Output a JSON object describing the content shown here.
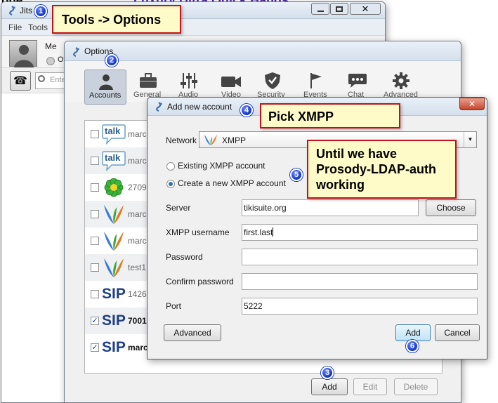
{
  "top_fragments": {
    "left": "one ...",
    "link": "Luxury Ultra Quick Hands"
  },
  "main_window": {
    "title": "Jits",
    "menu": [
      "File",
      "Tools"
    ],
    "profile_name": "Me",
    "status_fragment": "Ot",
    "search_placeholder": "Ente"
  },
  "options_window": {
    "title": "Options",
    "tabs": [
      {
        "label": "Accounts",
        "icon": "person-icon"
      },
      {
        "label": "General",
        "icon": "briefcase-icon"
      },
      {
        "label": "Audio",
        "icon": "sliders-icon"
      },
      {
        "label": "Video",
        "icon": "camera-icon"
      },
      {
        "label": "Security",
        "icon": "shield-icon"
      },
      {
        "label": "Events",
        "icon": "flag-icon"
      },
      {
        "label": "Chat",
        "icon": "chat-bubble-icon"
      },
      {
        "label": "Advanced",
        "icon": "gear-icon"
      }
    ],
    "accounts": [
      {
        "checked": false,
        "protocol": "talk",
        "name": "marc",
        "bold": false
      },
      {
        "checked": false,
        "protocol": "talk",
        "name": "marc",
        "bold": false
      },
      {
        "checked": false,
        "protocol": "icq",
        "name": "2709",
        "bold": false
      },
      {
        "checked": false,
        "protocol": "xmpp",
        "name": "marc",
        "bold": false
      },
      {
        "checked": false,
        "protocol": "xmpp",
        "name": "marc",
        "bold": false
      },
      {
        "checked": false,
        "protocol": "xmpp",
        "name": "test1",
        "bold": false
      },
      {
        "checked": false,
        "protocol": "sip",
        "name": "1426",
        "bold": false
      },
      {
        "checked": true,
        "protocol": "sip",
        "name": "7001",
        "bold": true
      },
      {
        "checked": true,
        "protocol": "sip",
        "name": "marc",
        "bold": true
      }
    ],
    "protocol_text": {
      "talk": "talk",
      "sip": "SIP"
    },
    "buttons": {
      "add": "Add",
      "edit": "Edit",
      "delete": "Delete"
    }
  },
  "dialog": {
    "title": "Add new account",
    "network_label": "Network",
    "network_value": "XMPP",
    "radio_existing": "Existing XMPP account",
    "radio_create": "Create a new XMPP account",
    "selected_radio": "create",
    "fields": [
      {
        "label": "Server",
        "value": ""
      },
      {
        "label": "XMPP username",
        "value": "first.last"
      },
      {
        "label": "Password",
        "value": ""
      },
      {
        "label": "Confirm password",
        "value": ""
      },
      {
        "label": "Port",
        "value": "5222"
      }
    ],
    "server_value": "tikisuite.org",
    "choose_button": "Choose",
    "advanced_button": "Advanced",
    "add_button": "Add",
    "cancel_button": "Cancel"
  },
  "callouts": {
    "tools_options": "Tools -> Options",
    "pick_xmpp": "Pick XMPP",
    "prosody": [
      "Until we have",
      "Prosody-LDAP-auth",
      "working"
    ]
  },
  "badges": [
    "1",
    "2",
    "3",
    "4",
    "5",
    "6"
  ],
  "colors": {
    "callout_border": "#c0121a",
    "callout_fill": "#fffbc8",
    "badge": "#1236c8",
    "selection": "#c9dff6"
  }
}
